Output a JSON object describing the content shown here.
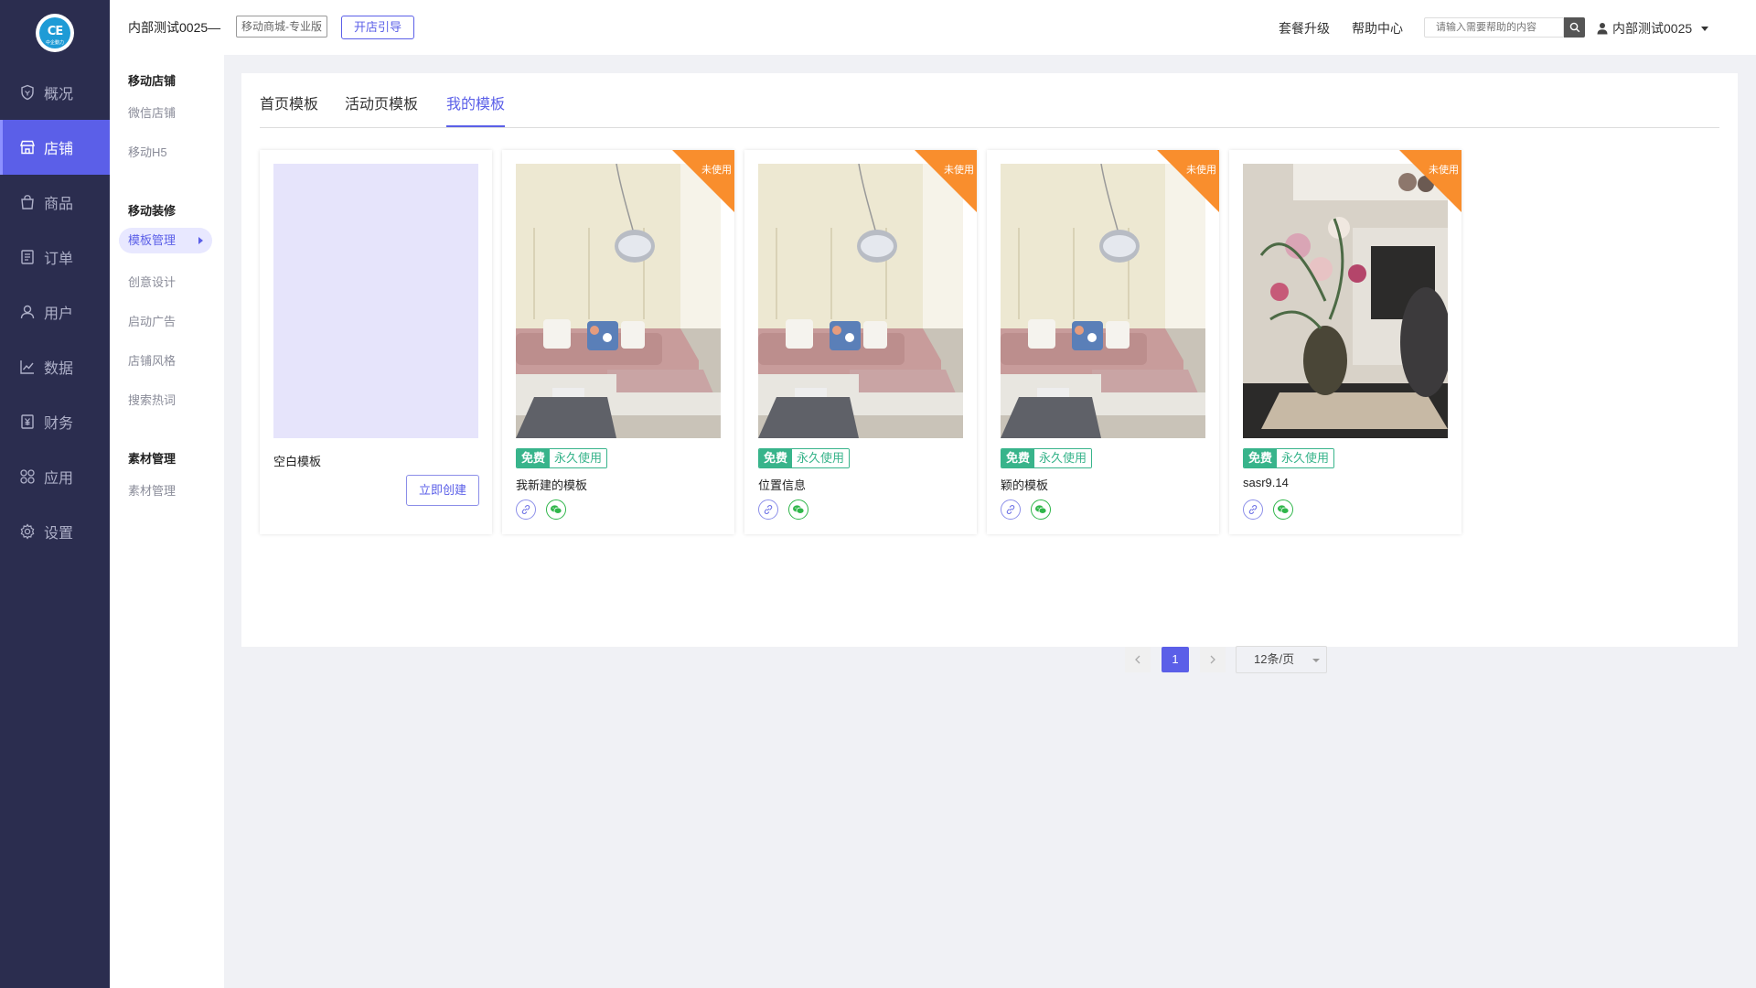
{
  "logo": {
    "mark": "CE",
    "sub": "中企動力"
  },
  "main_nav": [
    {
      "label": "概况",
      "icon": "shield-icon",
      "active": false
    },
    {
      "label": "店铺",
      "icon": "store-icon",
      "active": true
    },
    {
      "label": "商品",
      "icon": "bag-icon",
      "active": false
    },
    {
      "label": "订单",
      "icon": "order-icon",
      "active": false
    },
    {
      "label": "用户",
      "icon": "user-icon",
      "active": false
    },
    {
      "label": "数据",
      "icon": "chart-icon",
      "active": false
    },
    {
      "label": "财务",
      "icon": "finance-icon",
      "active": false
    },
    {
      "label": "应用",
      "icon": "apps-icon",
      "active": false
    },
    {
      "label": "设置",
      "icon": "settings-icon",
      "active": false
    }
  ],
  "sub_nav": {
    "group1": "移动店铺",
    "items1": [
      "微信店铺",
      "移动H5"
    ],
    "group2": "移动装修",
    "items2": [
      "模板管理",
      "创意设计",
      "启动广告",
      "店铺风格",
      "搜索热词"
    ],
    "active_item": "模板管理",
    "group3": "素材管理",
    "items3": [
      "素材管理"
    ]
  },
  "header": {
    "shop_name": "内部测试0025—",
    "edition": "移动商城-专业版",
    "guide_button": "开店引导",
    "upgrade_link": "套餐升级",
    "help_link": "帮助中心",
    "search_placeholder": "请输入需要帮助的内容",
    "user_name": "内部测试0025"
  },
  "tabs": [
    "首页模板",
    "活动页模板",
    "我的模板"
  ],
  "active_tab": "我的模板",
  "blank_card": {
    "title": "空白模板",
    "create_button": "立即创建"
  },
  "templates": [
    {
      "name": "我新建的模板",
      "badge": "未使用",
      "price_tag": "免费",
      "term_tag": "永久使用",
      "image": "sofa"
    },
    {
      "name": "位置信息",
      "badge": "未使用",
      "price_tag": "免费",
      "term_tag": "永久使用",
      "image": "sofa"
    },
    {
      "name": "颖的模板",
      "badge": "未使用",
      "price_tag": "免费",
      "term_tag": "永久使用",
      "image": "sofa"
    },
    {
      "name": "sasr9.14",
      "badge": "未使用",
      "price_tag": "免费",
      "term_tag": "永久使用",
      "image": "flowers"
    }
  ],
  "pagination": {
    "current_page": "1",
    "page_size": "12条/页"
  },
  "colors": {
    "accent": "#5b5fe8",
    "nav_bg": "#2b2d4f",
    "ribbon": "#f98e2d",
    "tag_green": "#38b48b",
    "wechat_green": "#2fb64a"
  }
}
